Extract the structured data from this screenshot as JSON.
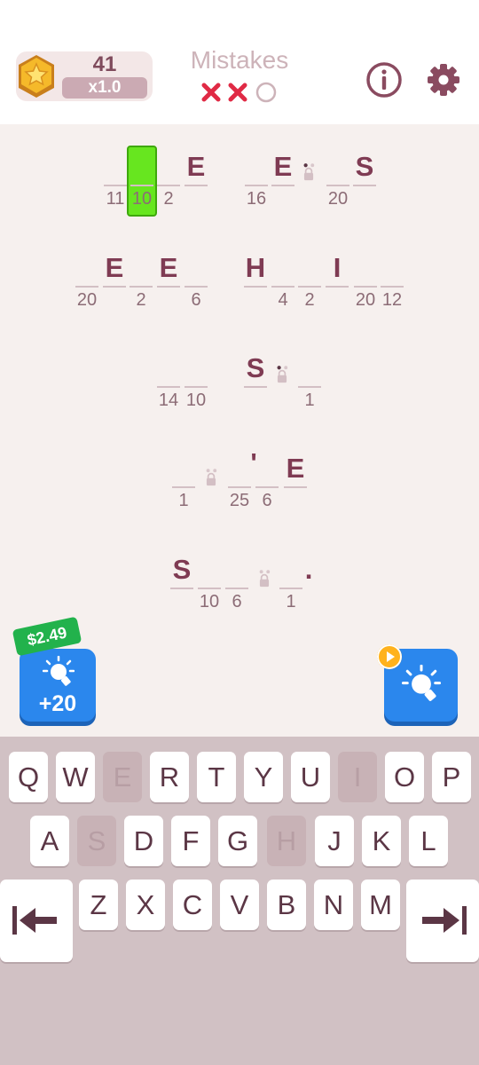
{
  "header": {
    "score": "41",
    "multiplier": "x1.0",
    "mistakes_label": "Mistakes",
    "mistakes_used": 2,
    "mistakes_total": 3
  },
  "puzzle": {
    "cells": [
      {
        "ch": "",
        "num": "11"
      },
      {
        "ch": "",
        "num": "10"
      },
      {
        "ch": "",
        "num": "2"
      },
      {
        "ch": "E",
        "num": ""
      },
      {
        "ch": "",
        "num": "16"
      },
      {
        "ch": "E",
        "num": ""
      },
      {
        "ch": "",
        "num": "20"
      },
      {
        "ch": "S",
        "num": ""
      },
      {
        "ch": "",
        "num": "20"
      },
      {
        "ch": "E",
        "num": ""
      },
      {
        "ch": "",
        "num": "2"
      },
      {
        "ch": "E",
        "num": ""
      },
      {
        "ch": "",
        "num": "6"
      },
      {
        "ch": "H",
        "num": ""
      },
      {
        "ch": "",
        "num": "4"
      },
      {
        "ch": "",
        "num": "2"
      },
      {
        "ch": "I",
        "num": ""
      },
      {
        "ch": "",
        "num": "20"
      },
      {
        "ch": "",
        "num": "12"
      },
      {
        "ch": "",
        "num": "14"
      },
      {
        "ch": "",
        "num": "10"
      },
      {
        "ch": "S",
        "num": ""
      },
      {
        "ch": "",
        "num": "1"
      },
      {
        "ch": "",
        "num": "1"
      },
      {
        "ch": "'",
        "num": ""
      },
      {
        "ch": "",
        "num": "25"
      },
      {
        "ch": "",
        "num": "6"
      },
      {
        "ch": "E",
        "num": ""
      },
      {
        "ch": "S",
        "num": ""
      },
      {
        "ch": "",
        "num": "10"
      },
      {
        "ch": "",
        "num": "6"
      },
      {
        "ch": "",
        "num": "1"
      },
      {
        "ch": ".",
        "num": ""
      }
    ]
  },
  "buy_hints": {
    "price": "$2.49",
    "amount": "+20"
  },
  "keyboard": {
    "row1": [
      "Q",
      "W",
      "E",
      "R",
      "T",
      "Y",
      "U",
      "I",
      "O",
      "P"
    ],
    "row2": [
      "A",
      "S",
      "D",
      "F",
      "G",
      "H",
      "J",
      "K",
      "L"
    ],
    "row3": [
      "Z",
      "X",
      "C",
      "V",
      "B",
      "N",
      "M"
    ],
    "used_keys": [
      "E",
      "I",
      "S",
      "H"
    ]
  },
  "colors": {
    "active_cell": "#67e61f",
    "mistake_x": "#e02a45",
    "button_blue": "#2b87ed",
    "price_green": "#22b24c"
  }
}
